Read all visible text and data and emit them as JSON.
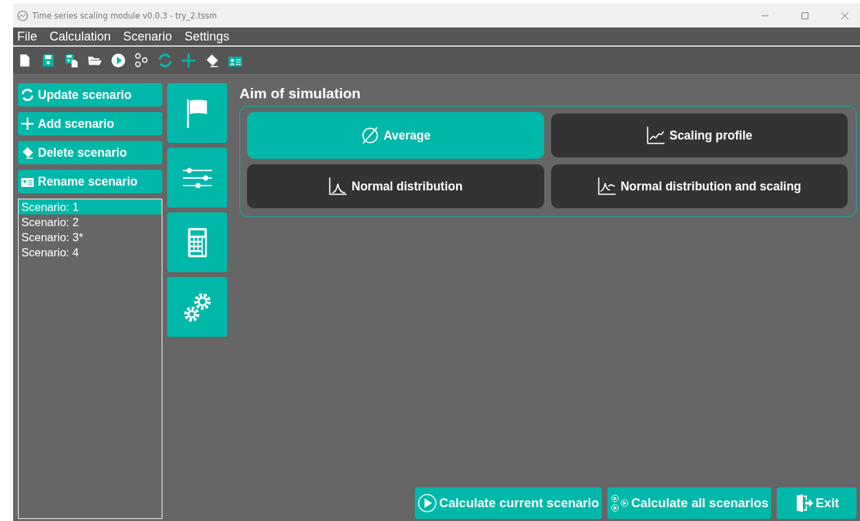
{
  "window": {
    "title": "Time series scaling module v0.0.3  - try_2.tssm"
  },
  "menu": [
    "File",
    "Calculation",
    "Scenario",
    "Settings"
  ],
  "scenario_buttons": [
    "Update scenario",
    "Add scenario",
    "Delete scenario",
    "Rename scenario"
  ],
  "scenarios": [
    {
      "label": "Scenario: 1",
      "selected": true
    },
    {
      "label": "Scenario: 2",
      "selected": false
    },
    {
      "label": "Scenario: 3*",
      "selected": false
    },
    {
      "label": "Scenario: 4",
      "selected": false
    }
  ],
  "section_title": "Aim of simulation",
  "aims": [
    {
      "label": "Average",
      "selected": true
    },
    {
      "label": "Scaling profile",
      "selected": false
    },
    {
      "label": "Normal distribution",
      "selected": false
    },
    {
      "label": "Normal distribution and scaling",
      "selected": false
    }
  ],
  "footer_buttons": [
    "Calculate current scenario",
    "Calculate all scenarios",
    "Exit"
  ]
}
